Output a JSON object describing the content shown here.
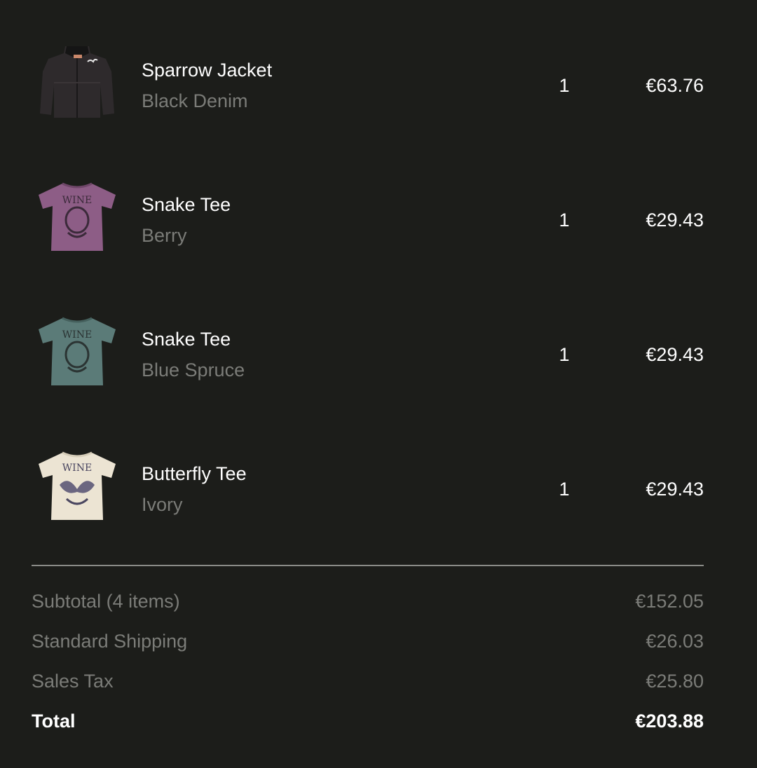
{
  "cart": {
    "items": [
      {
        "name": "Sparrow Jacket",
        "variant": "Black Denim",
        "quantity": "1",
        "price": "€63.76",
        "image_icon": "jacket-icon",
        "image_color": "#2e2a2c"
      },
      {
        "name": "Snake Tee",
        "variant": "Berry",
        "quantity": "1",
        "price": "€29.43",
        "image_icon": "tshirt-icon",
        "image_color": "#8d5d86"
      },
      {
        "name": "Snake Tee",
        "variant": "Blue Spruce",
        "quantity": "1",
        "price": "€29.43",
        "image_icon": "tshirt-icon",
        "image_color": "#5b7b78"
      },
      {
        "name": "Butterfly Tee",
        "variant": "Ivory",
        "quantity": "1",
        "price": "€29.43",
        "image_icon": "tshirt-icon",
        "image_color": "#ece4d3"
      }
    ]
  },
  "summary": {
    "subtotal_label": "Subtotal (4 items)",
    "subtotal_value": "€152.05",
    "shipping_label": "Standard Shipping",
    "shipping_value": "€26.03",
    "tax_label": "Sales Tax",
    "tax_value": "€25.80",
    "total_label": "Total",
    "total_value": "€203.88"
  },
  "colors": {
    "background": "#1c1d1a",
    "primary_text": "#ffffff",
    "secondary_text": "#7b7c78",
    "divider": "#8a8b87"
  }
}
